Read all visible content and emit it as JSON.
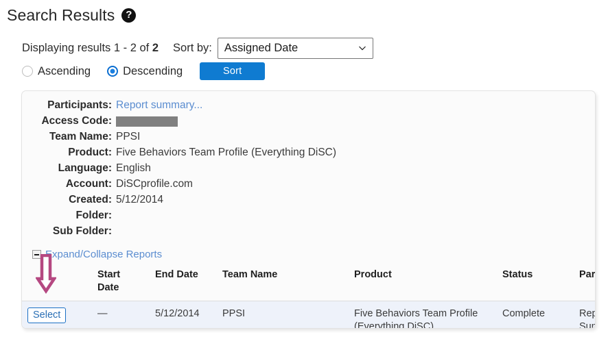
{
  "header": {
    "title": "Search Results",
    "help_icon": "question-mark-circle-icon"
  },
  "controls": {
    "displaying_prefix": "Displaying results 1 - 2 of ",
    "displaying_count": "2",
    "sort_by_label": "Sort by:",
    "sort_by_value": "Assigned Date",
    "sort_by_options": [
      "Assigned Date"
    ],
    "radio_ascending": "Ascending",
    "radio_descending": "Descending",
    "selected_order": "Descending",
    "sort_button": "Sort"
  },
  "detail": {
    "fields": [
      {
        "label": "Participants:",
        "value": "Report summary...",
        "type": "link"
      },
      {
        "label": "Access Code:",
        "value": "",
        "type": "redacted"
      },
      {
        "label": "Team Name:",
        "value": "PPSI",
        "type": "text"
      },
      {
        "label": "Product:",
        "value": "Five Behaviors Team Profile (Everything DiSC)",
        "type": "text"
      },
      {
        "label": "Language:",
        "value": "English",
        "type": "text"
      },
      {
        "label": "Account:",
        "value": "DiSCprofile.com",
        "type": "text"
      },
      {
        "label": "Created:",
        "value": "5/12/2014",
        "type": "text"
      },
      {
        "label": "Folder:",
        "value": "",
        "type": "text"
      },
      {
        "label": "Sub Folder:",
        "value": "",
        "type": "text"
      }
    ]
  },
  "expand": {
    "toggle_icon": "collapse-minus-box-icon",
    "label": "Expand/Collapse Reports"
  },
  "reports_table": {
    "columns": [
      "",
      "Start Date",
      "End Date",
      "Team Name",
      "Product",
      "Status",
      "Participants"
    ],
    "rows": [
      {
        "select_label": "Select",
        "start_date": "—",
        "end_date": "5/12/2014",
        "team_name": "PPSI",
        "product": "Five Behaviors Team Profile (Everything DiSC)",
        "status": "Complete",
        "participants": "Report Summary..."
      }
    ]
  },
  "annotation": {
    "arrow": "down-arrow-annotation",
    "color": "#b54881"
  },
  "colors": {
    "accent_blue": "#0f7bd1",
    "link_blue": "#5b8dd0",
    "row_highlight": "#eef2fa",
    "redaction": "#808080",
    "annotation": "#b54881"
  }
}
